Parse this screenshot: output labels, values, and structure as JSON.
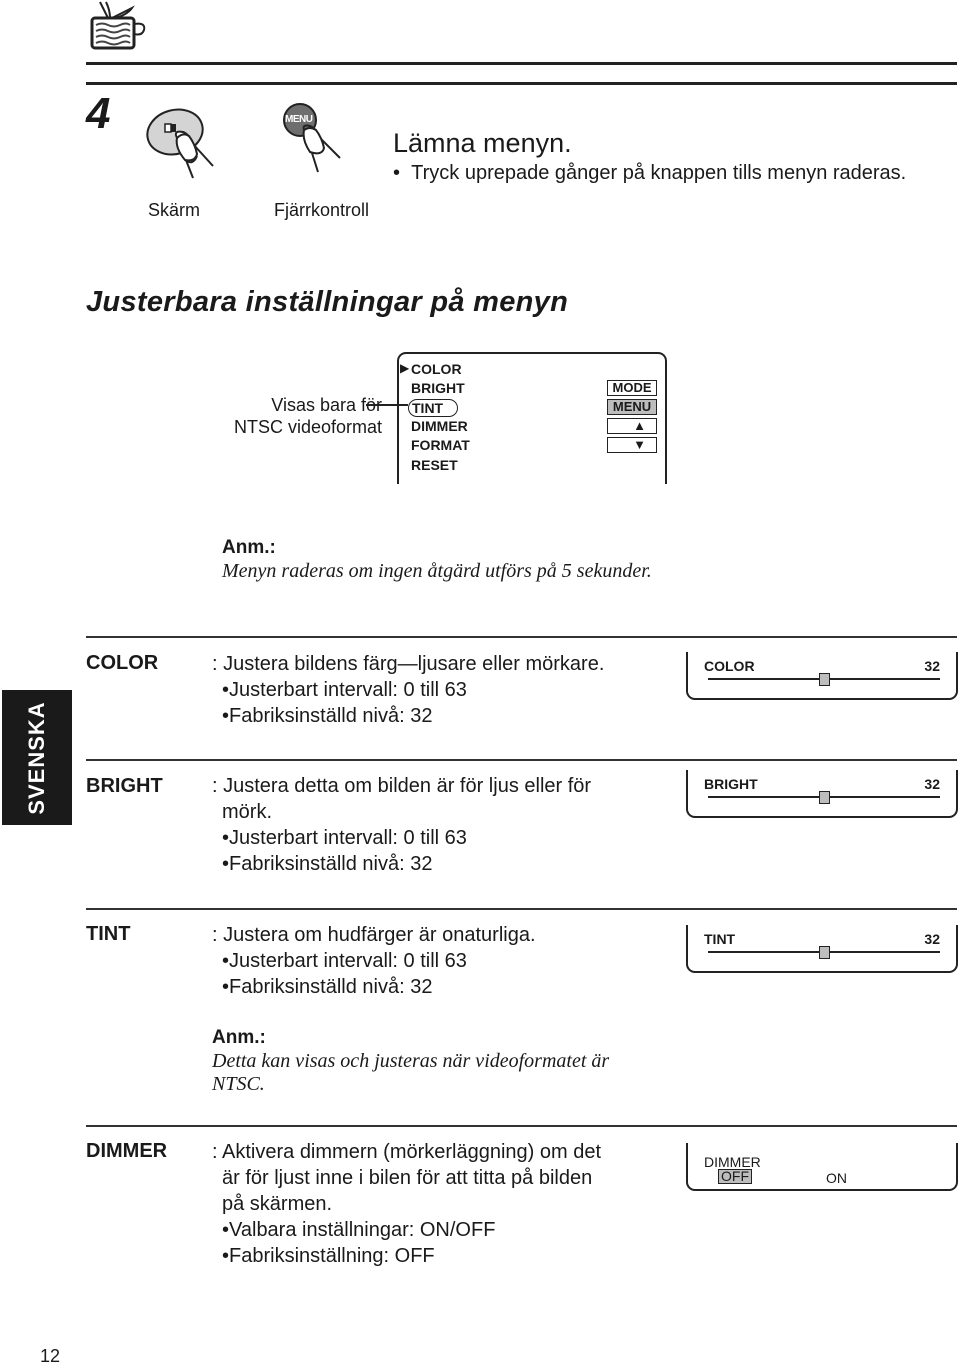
{
  "header": {
    "icon": "tv-icon"
  },
  "step": {
    "number": "4",
    "screen_caption": "Skärm",
    "remote_caption": "Fjärrkontroll",
    "remote_button_label": "MENU",
    "title": "Lämna menyn.",
    "bullet": "Tryck uprepade gånger på knappen tills menyn raderas."
  },
  "section": {
    "title": "Justerbara inställningar på menyn"
  },
  "menu_diagram": {
    "callout_line1": "Visas bara för",
    "callout_line2": "NTSC videoformat",
    "selected_marker": "▶",
    "items": [
      "COLOR",
      "BRIGHT",
      "TINT",
      "DIMMER",
      "FORMAT",
      "RESET"
    ],
    "buttons": [
      "MODE",
      "MENU",
      "▲",
      "▼"
    ]
  },
  "note1": {
    "label": "Anm.:",
    "text": "Menyn raderas om ingen åtgärd utförs på 5 sekunder."
  },
  "side_tab": "SVENSKA",
  "settings": [
    {
      "term": "COLOR",
      "desc": [
        ": Justera bildens färg—ljusare eller mörkare."
      ],
      "bullets": [
        "Justerbart intervall: 0 till 63",
        "Fabriksinställd nivå: 32"
      ],
      "osd": {
        "label": "COLOR",
        "value": "32",
        "level_fraction": 0.5
      }
    },
    {
      "term": "BRIGHT",
      "desc": [
        ": Justera detta om bilden är för ljus eller för",
        "mörk."
      ],
      "bullets": [
        "Justerbart intervall: 0 till 63",
        "Fabriksinställd nivå: 32"
      ],
      "osd": {
        "label": "BRIGHT",
        "value": "32",
        "level_fraction": 0.5
      }
    },
    {
      "term": "TINT",
      "desc": [
        ": Justera om hudfärger är onaturliga."
      ],
      "bullets": [
        "Justerbart intervall: 0 till 63",
        "Fabriksinställd nivå: 32"
      ],
      "osd": {
        "label": "TINT",
        "value": "32",
        "level_fraction": 0.5
      },
      "note_label": "Anm.:",
      "note_line1": "Detta kan visas och justeras när videoformatet är",
      "note_line2": "NTSC."
    },
    {
      "term": "DIMMER",
      "desc": [
        ": Aktivera dimmern (mörkerläggning) om det",
        "är för ljust inne i bilen för att titta på bilden",
        "på skärmen."
      ],
      "bullets": [
        "Valbara inställningar: ON/OFF",
        "Fabriksinställning: OFF"
      ],
      "osd": {
        "label": "DIMMER",
        "options": [
          "OFF",
          "ON"
        ],
        "selected": "OFF"
      }
    }
  ],
  "bullet_char": "•",
  "page_number": "12"
}
